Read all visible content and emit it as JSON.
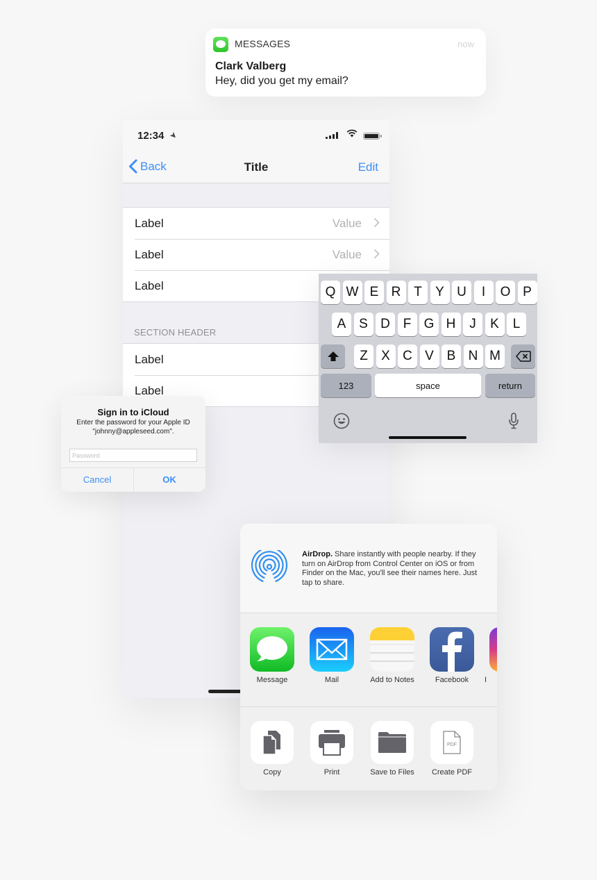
{
  "notification": {
    "app_name": "MESSAGES",
    "time": "now",
    "sender": "Clark Valberg",
    "message": "Hey, did you get my email?"
  },
  "phone": {
    "status_bar": {
      "time": "12:34"
    },
    "nav": {
      "back_label": "Back",
      "title": "Title",
      "edit_label": "Edit"
    },
    "group1": [
      {
        "label": "Label",
        "value": "Value"
      },
      {
        "label": "Label",
        "value": "Value"
      },
      {
        "label": "Label",
        "value": ""
      }
    ],
    "section_header": "SECTION HEADER",
    "group2": [
      {
        "label": "Label"
      },
      {
        "label": "Label"
      }
    ]
  },
  "alert": {
    "title": "Sign in to iCloud",
    "message_line1": "Enter the password for your Apple ID",
    "message_line2": "\"johnny@appleseed.com\".",
    "password_placeholder": "Password",
    "cancel_label": "Cancel",
    "ok_label": "OK"
  },
  "keyboard": {
    "row1": [
      "Q",
      "W",
      "E",
      "R",
      "T",
      "Y",
      "U",
      "I",
      "O",
      "P"
    ],
    "row2": [
      "A",
      "S",
      "D",
      "F",
      "G",
      "H",
      "J",
      "K",
      "L"
    ],
    "row3": [
      "Z",
      "X",
      "C",
      "V",
      "B",
      "N",
      "M"
    ],
    "numbers_label": "123",
    "space_label": "space",
    "return_label": "return"
  },
  "share_sheet": {
    "airdrop_title": "AirDrop.",
    "airdrop_text": " Share instantly with people nearby. If they turn on AirDrop from Control Center on iOS or from Finder on the Mac, you'll see their names here. Just tap to share.",
    "apps": [
      {
        "label": "Message",
        "icon": "message-app-icon"
      },
      {
        "label": "Mail",
        "icon": "mail-app-icon"
      },
      {
        "label": "Add to Notes",
        "icon": "notes-app-icon"
      },
      {
        "label": "Facebook",
        "icon": "facebook-app-icon"
      },
      {
        "label": "I",
        "icon": "instagram-app-icon"
      }
    ],
    "actions": [
      {
        "label": "Copy",
        "icon": "copy-icon"
      },
      {
        "label": "Print",
        "icon": "print-icon"
      },
      {
        "label": "Save to Files",
        "icon": "folder-icon"
      },
      {
        "label": "Create PDF",
        "icon": "pdf-icon",
        "glyph_text": "PDF"
      }
    ]
  },
  "colors": {
    "accent_blue": "#3d8ef7",
    "messages_green": "#2ec52a",
    "facebook_blue": "#3b5998",
    "notes_yellow": "#fdd136",
    "action_gray": "#636369"
  }
}
